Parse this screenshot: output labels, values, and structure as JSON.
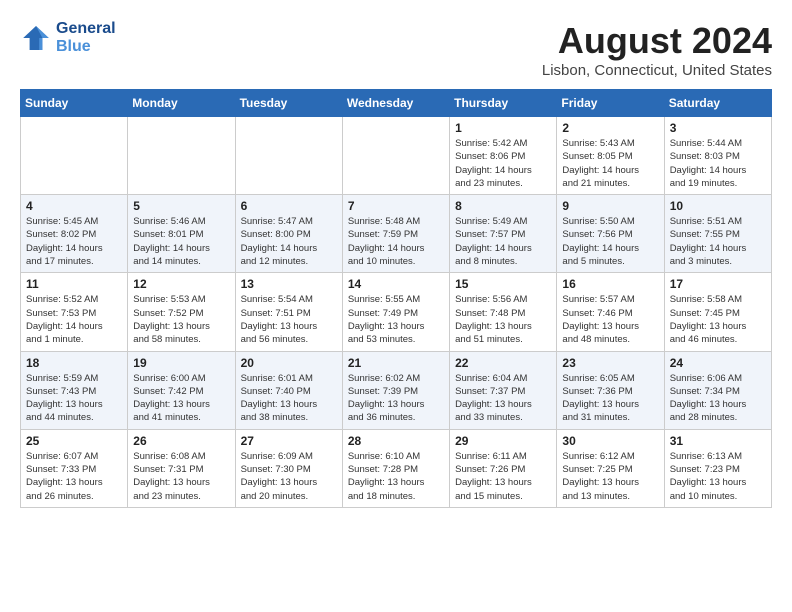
{
  "header": {
    "logo_line1": "General",
    "logo_line2": "Blue",
    "month": "August 2024",
    "location": "Lisbon, Connecticut, United States"
  },
  "days_of_week": [
    "Sunday",
    "Monday",
    "Tuesday",
    "Wednesday",
    "Thursday",
    "Friday",
    "Saturday"
  ],
  "weeks": [
    [
      {
        "day": "",
        "info": ""
      },
      {
        "day": "",
        "info": ""
      },
      {
        "day": "",
        "info": ""
      },
      {
        "day": "",
        "info": ""
      },
      {
        "day": "1",
        "info": "Sunrise: 5:42 AM\nSunset: 8:06 PM\nDaylight: 14 hours\nand 23 minutes."
      },
      {
        "day": "2",
        "info": "Sunrise: 5:43 AM\nSunset: 8:05 PM\nDaylight: 14 hours\nand 21 minutes."
      },
      {
        "day": "3",
        "info": "Sunrise: 5:44 AM\nSunset: 8:03 PM\nDaylight: 14 hours\nand 19 minutes."
      }
    ],
    [
      {
        "day": "4",
        "info": "Sunrise: 5:45 AM\nSunset: 8:02 PM\nDaylight: 14 hours\nand 17 minutes."
      },
      {
        "day": "5",
        "info": "Sunrise: 5:46 AM\nSunset: 8:01 PM\nDaylight: 14 hours\nand 14 minutes."
      },
      {
        "day": "6",
        "info": "Sunrise: 5:47 AM\nSunset: 8:00 PM\nDaylight: 14 hours\nand 12 minutes."
      },
      {
        "day": "7",
        "info": "Sunrise: 5:48 AM\nSunset: 7:59 PM\nDaylight: 14 hours\nand 10 minutes."
      },
      {
        "day": "8",
        "info": "Sunrise: 5:49 AM\nSunset: 7:57 PM\nDaylight: 14 hours\nand 8 minutes."
      },
      {
        "day": "9",
        "info": "Sunrise: 5:50 AM\nSunset: 7:56 PM\nDaylight: 14 hours\nand 5 minutes."
      },
      {
        "day": "10",
        "info": "Sunrise: 5:51 AM\nSunset: 7:55 PM\nDaylight: 14 hours\nand 3 minutes."
      }
    ],
    [
      {
        "day": "11",
        "info": "Sunrise: 5:52 AM\nSunset: 7:53 PM\nDaylight: 14 hours\nand 1 minute."
      },
      {
        "day": "12",
        "info": "Sunrise: 5:53 AM\nSunset: 7:52 PM\nDaylight: 13 hours\nand 58 minutes."
      },
      {
        "day": "13",
        "info": "Sunrise: 5:54 AM\nSunset: 7:51 PM\nDaylight: 13 hours\nand 56 minutes."
      },
      {
        "day": "14",
        "info": "Sunrise: 5:55 AM\nSunset: 7:49 PM\nDaylight: 13 hours\nand 53 minutes."
      },
      {
        "day": "15",
        "info": "Sunrise: 5:56 AM\nSunset: 7:48 PM\nDaylight: 13 hours\nand 51 minutes."
      },
      {
        "day": "16",
        "info": "Sunrise: 5:57 AM\nSunset: 7:46 PM\nDaylight: 13 hours\nand 48 minutes."
      },
      {
        "day": "17",
        "info": "Sunrise: 5:58 AM\nSunset: 7:45 PM\nDaylight: 13 hours\nand 46 minutes."
      }
    ],
    [
      {
        "day": "18",
        "info": "Sunrise: 5:59 AM\nSunset: 7:43 PM\nDaylight: 13 hours\nand 44 minutes."
      },
      {
        "day": "19",
        "info": "Sunrise: 6:00 AM\nSunset: 7:42 PM\nDaylight: 13 hours\nand 41 minutes."
      },
      {
        "day": "20",
        "info": "Sunrise: 6:01 AM\nSunset: 7:40 PM\nDaylight: 13 hours\nand 38 minutes."
      },
      {
        "day": "21",
        "info": "Sunrise: 6:02 AM\nSunset: 7:39 PM\nDaylight: 13 hours\nand 36 minutes."
      },
      {
        "day": "22",
        "info": "Sunrise: 6:04 AM\nSunset: 7:37 PM\nDaylight: 13 hours\nand 33 minutes."
      },
      {
        "day": "23",
        "info": "Sunrise: 6:05 AM\nSunset: 7:36 PM\nDaylight: 13 hours\nand 31 minutes."
      },
      {
        "day": "24",
        "info": "Sunrise: 6:06 AM\nSunset: 7:34 PM\nDaylight: 13 hours\nand 28 minutes."
      }
    ],
    [
      {
        "day": "25",
        "info": "Sunrise: 6:07 AM\nSunset: 7:33 PM\nDaylight: 13 hours\nand 26 minutes."
      },
      {
        "day": "26",
        "info": "Sunrise: 6:08 AM\nSunset: 7:31 PM\nDaylight: 13 hours\nand 23 minutes."
      },
      {
        "day": "27",
        "info": "Sunrise: 6:09 AM\nSunset: 7:30 PM\nDaylight: 13 hours\nand 20 minutes."
      },
      {
        "day": "28",
        "info": "Sunrise: 6:10 AM\nSunset: 7:28 PM\nDaylight: 13 hours\nand 18 minutes."
      },
      {
        "day": "29",
        "info": "Sunrise: 6:11 AM\nSunset: 7:26 PM\nDaylight: 13 hours\nand 15 minutes."
      },
      {
        "day": "30",
        "info": "Sunrise: 6:12 AM\nSunset: 7:25 PM\nDaylight: 13 hours\nand 13 minutes."
      },
      {
        "day": "31",
        "info": "Sunrise: 6:13 AM\nSunset: 7:23 PM\nDaylight: 13 hours\nand 10 minutes."
      }
    ]
  ]
}
